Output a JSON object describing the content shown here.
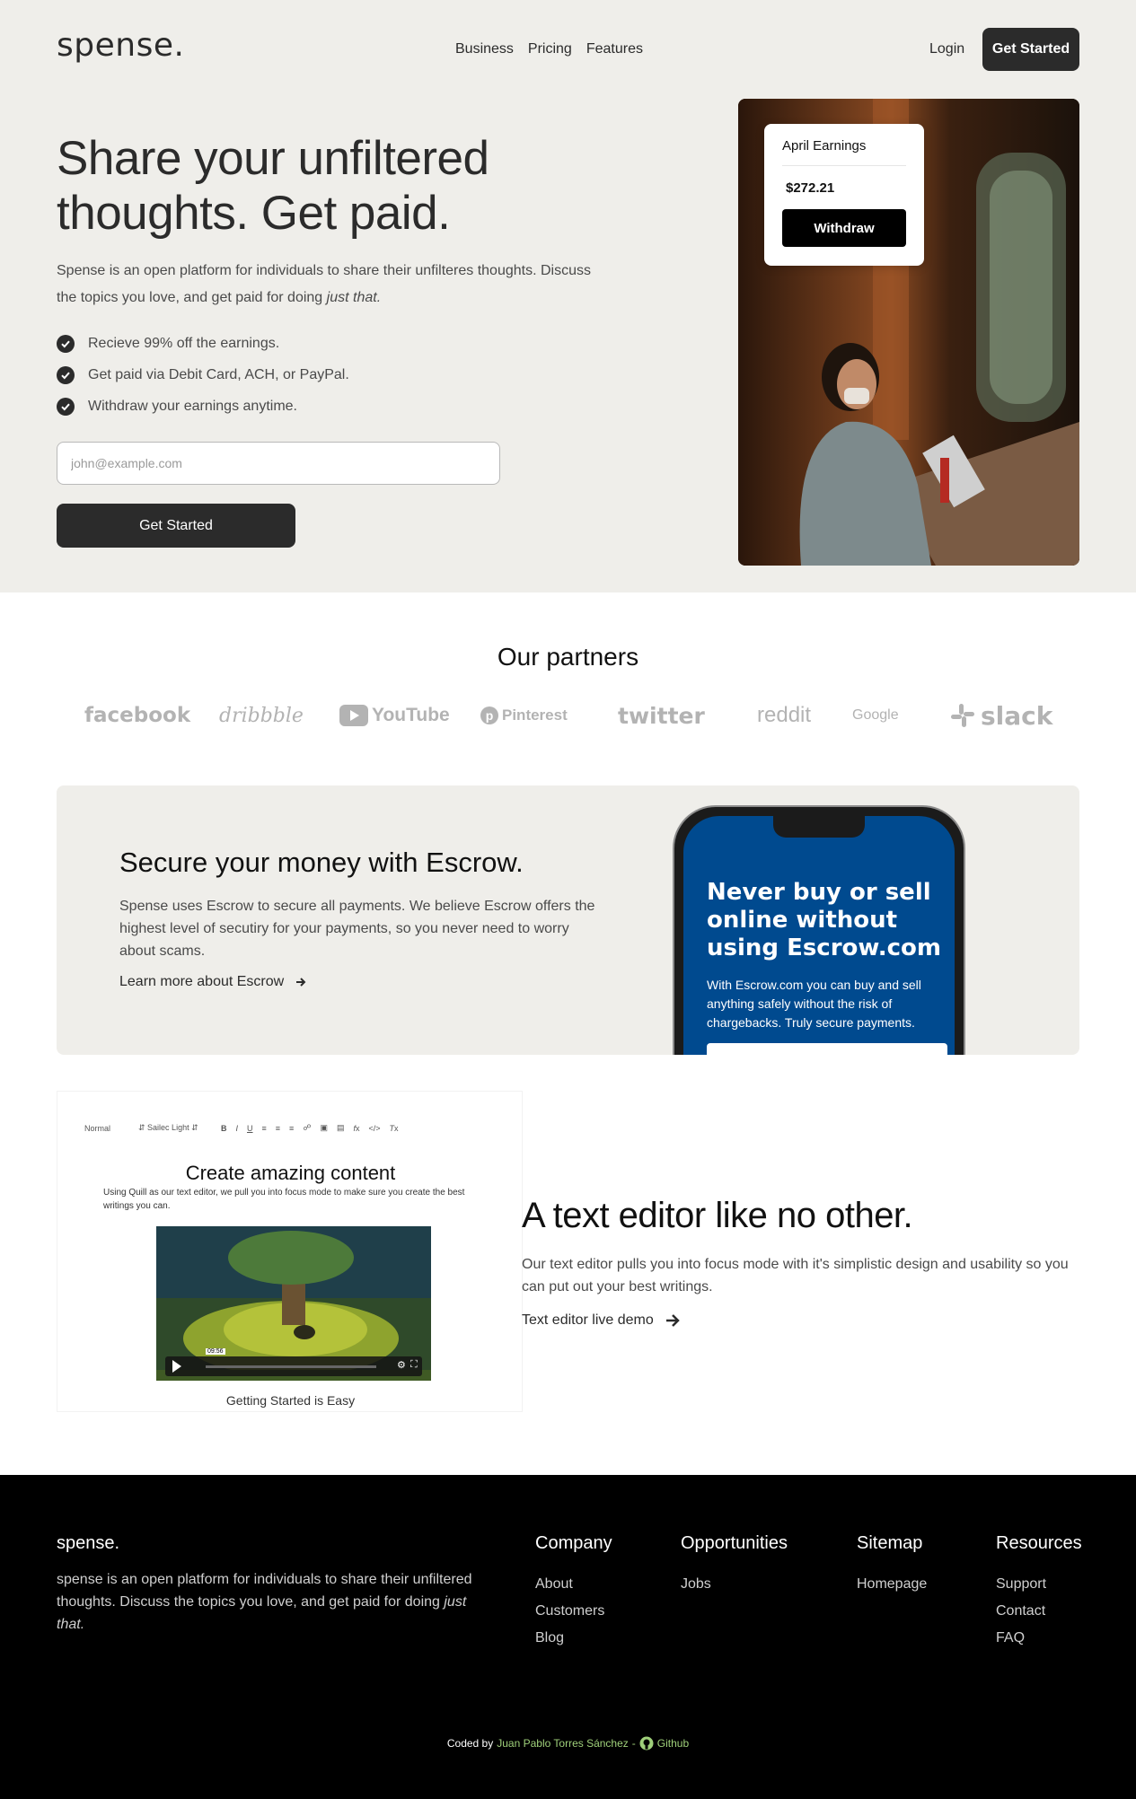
{
  "brand": {
    "logo": "spense."
  },
  "nav": {
    "items": [
      "Business",
      "Pricing",
      "Features"
    ],
    "login": "Login",
    "cta": "Get Started"
  },
  "hero": {
    "title_line1": "Share your unfiltered",
    "title_line2": "thoughts. Get paid.",
    "desc_main": "Spense is an open platform for individuals to share their unfilteres thoughts. Discuss the topics you love, and get paid for doing ",
    "desc_em": "just that.",
    "bullets": [
      "Recieve 99% off the earnings.",
      "Get paid via Debit Card, ACH, or PayPal.",
      "Withdraw your earnings anytime."
    ],
    "email_placeholder": "john@example.com",
    "cta": "Get Started"
  },
  "earnings_card": {
    "title": "April Earnings",
    "amount": "$272.21",
    "button": "Withdraw"
  },
  "partners": {
    "title": "Our partners",
    "logos": [
      "facebook",
      "dribbble",
      "YouTube",
      "Pinterest",
      "twitter",
      "reddit",
      "Google",
      "slack"
    ]
  },
  "escrow": {
    "title": "Secure your money with Escrow.",
    "desc": "Spense uses Escrow to secure all payments. We believe Escrow offers the highest level of secutiry for your payments, so you never need to worry about scams.",
    "link": "Learn more about Escrow",
    "phone_headline": "Never buy or sell online without using Escrow.com",
    "phone_sub": "With Escrow.com you can buy and sell anything safely without the risk of chargebacks. Truly secure payments."
  },
  "editor": {
    "toolbar_format": "Normal",
    "toolbar_font": "Sailec Light",
    "demo_heading": "Create amazing content",
    "demo_text": "Using Quill as our text editor, we pull you into focus mode to make sure you create the best writings you can.",
    "video_time": "09:56",
    "caption": "Getting Started is Easy",
    "title": "A text editor like no other.",
    "desc": "Our text editor pulls you into focus mode with it's simplistic design and usability so you can put out your best writings.",
    "link": "Text editor live demo"
  },
  "footer": {
    "logo": "spense.",
    "desc_main": "spense is an open platform for individuals to share their unfiltered thoughts. Discuss the topics you love, and get paid for doing ",
    "desc_em": "just that.",
    "columns": [
      {
        "title": "Company",
        "links": [
          "About",
          "Customers",
          "Blog"
        ]
      },
      {
        "title": "Opportunities",
        "links": [
          "Jobs"
        ]
      },
      {
        "title": "Sitemap",
        "links": [
          "Homepage"
        ]
      },
      {
        "title": "Resources",
        "links": [
          "Support",
          "Contact",
          "FAQ"
        ]
      }
    ],
    "credit_prefix": "Coded by",
    "credit_name": "Juan Pablo Torres Sánchez",
    "credit_sep": "-",
    "credit_link": "Github"
  }
}
